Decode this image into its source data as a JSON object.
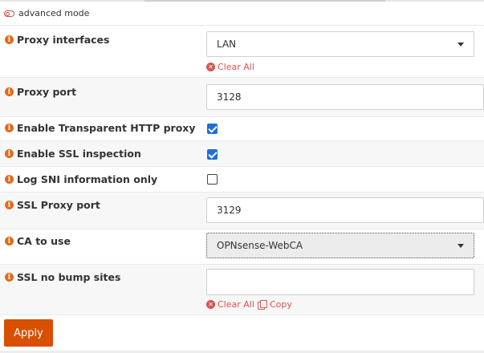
{
  "advanced_mode": {
    "label": "advanced mode"
  },
  "fields": {
    "proxy_interfaces": {
      "label": "Proxy interfaces",
      "value": "LAN",
      "clear_all": "Clear All"
    },
    "proxy_port": {
      "label": "Proxy port",
      "value": "3128"
    },
    "transparent_http": {
      "label": "Enable Transparent HTTP proxy",
      "checked": true
    },
    "ssl_inspection": {
      "label": "Enable SSL inspection",
      "checked": true
    },
    "log_sni": {
      "label": "Log SNI information only",
      "checked": false
    },
    "ssl_proxy_port": {
      "label": "SSL Proxy port",
      "value": "3129"
    },
    "ca_to_use": {
      "label": "CA to use",
      "value": "OPNsense-WebCA"
    },
    "ssl_no_bump": {
      "label": "SSL no bump sites",
      "value": "",
      "clear_all": "Clear All",
      "copy": "Copy"
    }
  },
  "apply_button": {
    "label": "Apply"
  },
  "colors": {
    "accent": "#d94f00",
    "info_icon": "#e36a1a",
    "link": "#d9534f",
    "checkbox": "#1e6fd6"
  }
}
